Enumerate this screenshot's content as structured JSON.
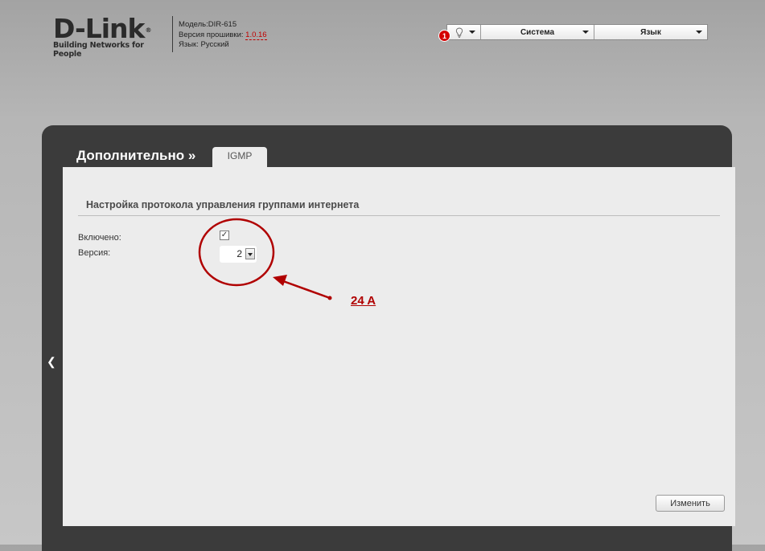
{
  "brand": {
    "name": "D-Link",
    "reg": "®",
    "tagline": "Building Networks for People"
  },
  "device": {
    "model_label": "Модель:",
    "model_value": "DIR-615",
    "firmware_label": "Версия прошивки: ",
    "firmware_value": "1.0.16",
    "language_label": "Язык: ",
    "language_value": "Русский"
  },
  "topmenu": {
    "notifications_count": "1",
    "system": "Система",
    "language": "Язык"
  },
  "breadcrumb": {
    "title": "Дополнительно »",
    "tab": "IGMP"
  },
  "section": {
    "title": "Настройка протокола управления группами интернета"
  },
  "form": {
    "enabled_label": "Включено:",
    "enabled_checked": true,
    "enabled_mark": "✓",
    "version_label": "Версия:",
    "version_value": "2"
  },
  "annotation": {
    "text": "24 A"
  },
  "actions": {
    "apply": "Изменить"
  },
  "colors": {
    "accent_red": "#b00000",
    "panel_dark": "#3b3b3b",
    "content_bg": "#ececec"
  }
}
